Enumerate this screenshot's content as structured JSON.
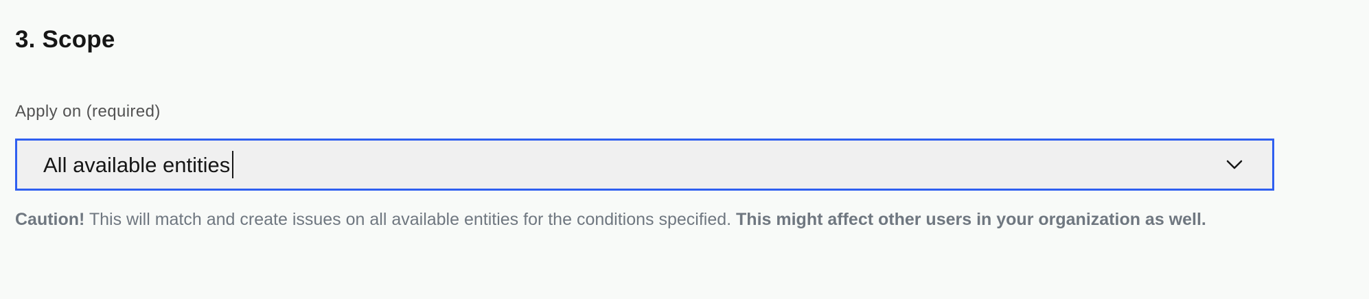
{
  "section": {
    "title": "3. Scope"
  },
  "field": {
    "label": "Apply on (required)",
    "selected_value": "All available entities",
    "accent_color": "#2f5ff0"
  },
  "helper": {
    "caution_label": "Caution!",
    "message": " This will match and create issues on all available entities for the conditions specified. ",
    "emphasis": "This might affect other users in your organization as well."
  },
  "icons": {
    "dropdown": "chevron-down-icon"
  }
}
